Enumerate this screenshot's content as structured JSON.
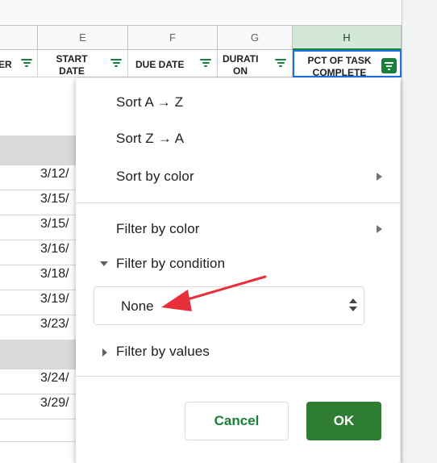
{
  "columns": {
    "letters": [
      "E",
      "F",
      "G",
      "H"
    ],
    "headers": {
      "d_partial": "ER",
      "e": "START DATE",
      "f": "DUE DATE",
      "g": "DURATI ON",
      "h": "PCT OF TASK COMPLETE"
    }
  },
  "rows": {
    "dates": [
      "3/12/",
      "3/15/",
      "3/15/",
      "3/16/",
      "3/18/",
      "3/19/",
      "3/23/",
      "3/24/",
      "3/29/"
    ]
  },
  "menu": {
    "sort_az": "Sort A → Z",
    "sort_za": "Sort Z → A",
    "sort_by_color": "Sort by color",
    "filter_by_color": "Filter by color",
    "filter_by_condition": "Filter by condition",
    "condition_value": "None",
    "filter_by_values": "Filter by values",
    "cancel": "Cancel",
    "ok": "OK"
  },
  "colors": {
    "accent_green": "#188038",
    "ok_button": "#2e7d32",
    "annotation_arrow": "#e8303a"
  },
  "icons": [
    "filter-icon",
    "submenu-arrow-icon",
    "caret-down-icon",
    "caret-right-icon",
    "select-arrows-icon"
  ]
}
